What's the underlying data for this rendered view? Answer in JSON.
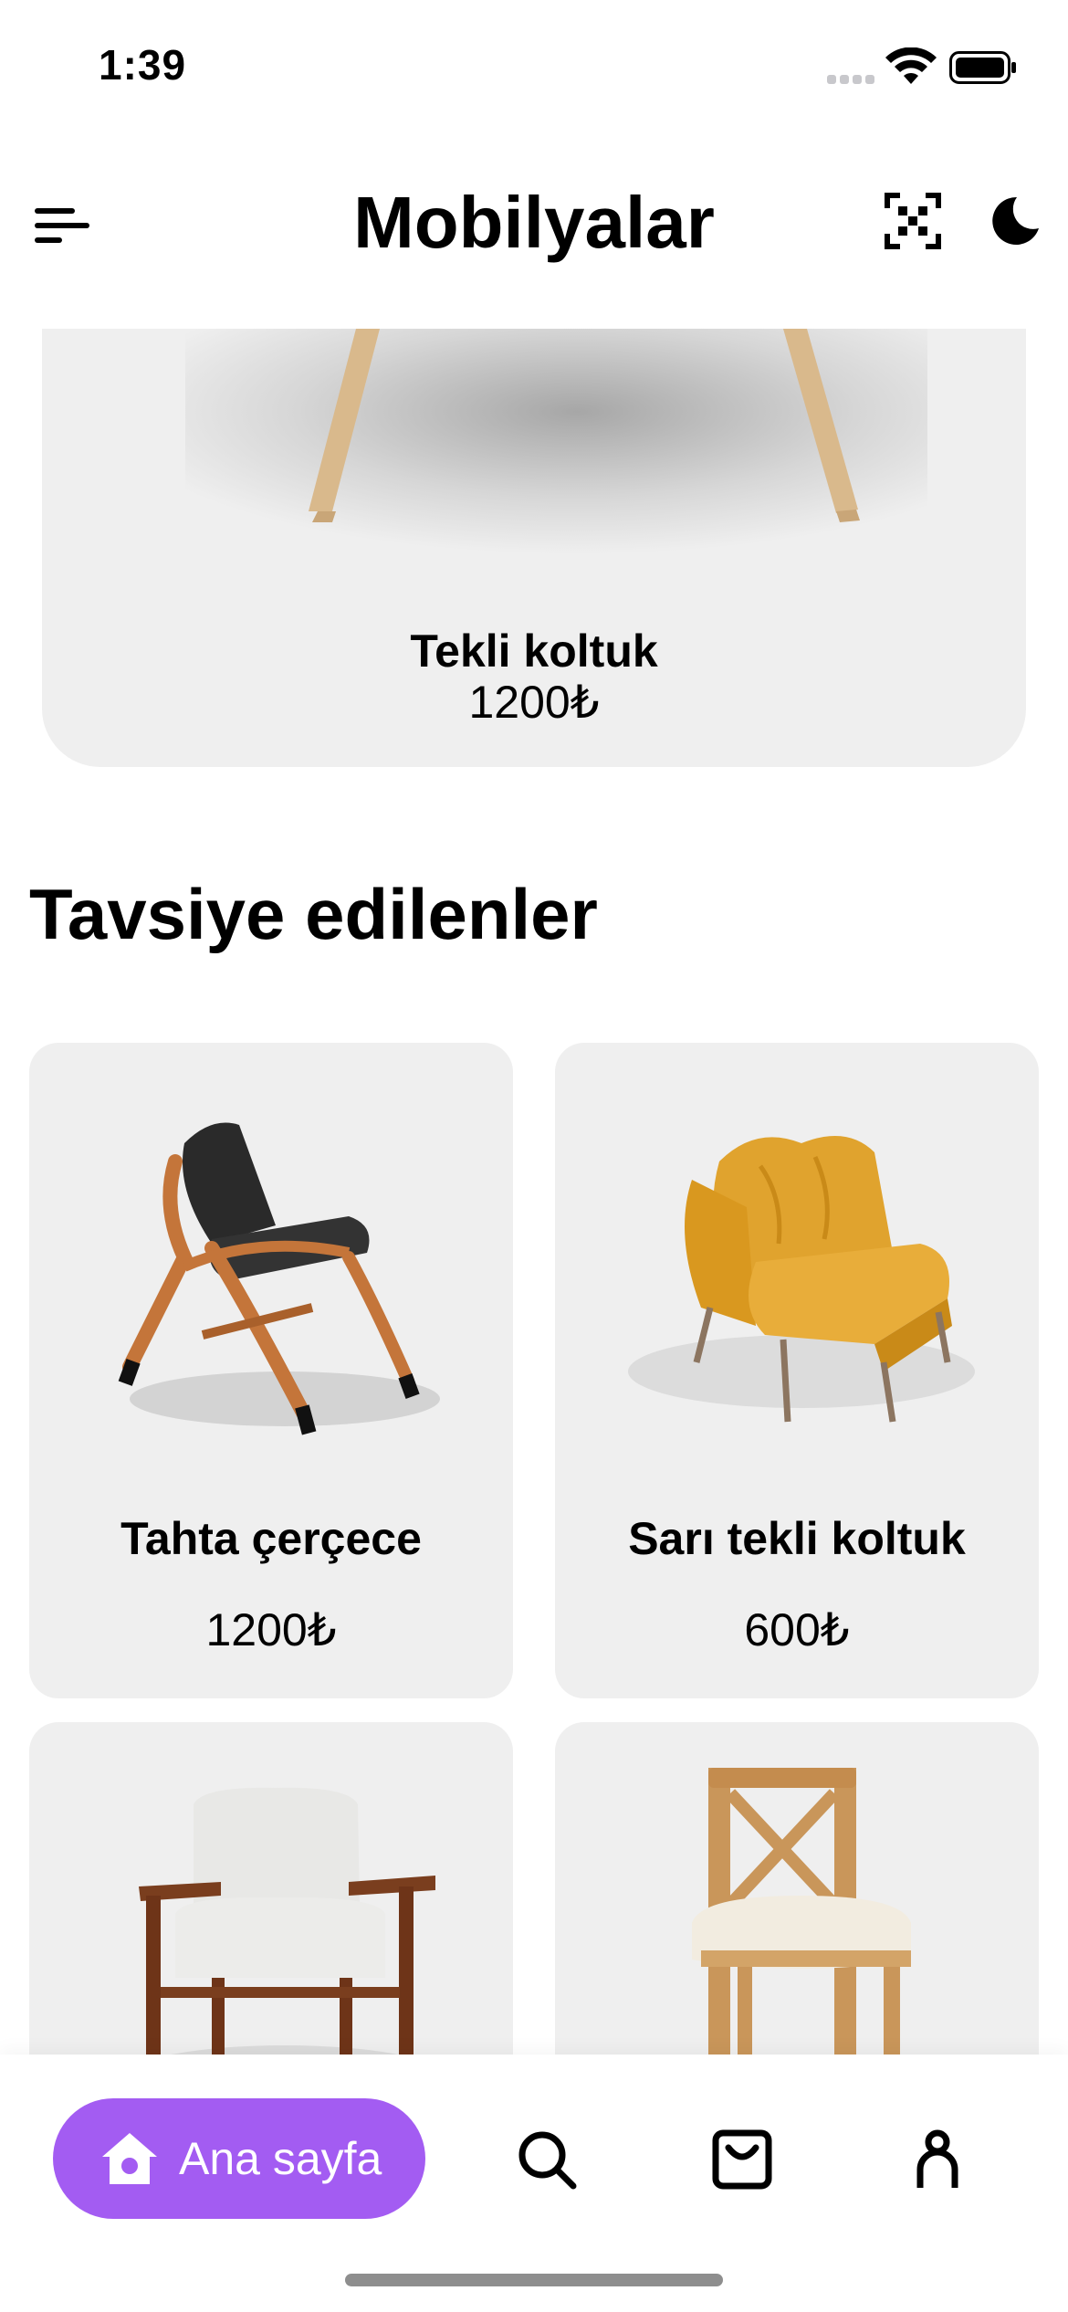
{
  "status_bar": {
    "time": "1:39"
  },
  "header": {
    "title": "Mobilyalar",
    "menu_icon": "menu-icon",
    "scan_icon": "qr-scan-icon",
    "theme_icon": "moon-icon"
  },
  "featured": {
    "name": "Tekli koltuk",
    "price": "1200₺"
  },
  "recommended": {
    "title": "Tavsiye edilenler",
    "items": [
      {
        "name": "Tahta çerçece",
        "price": "1200₺"
      },
      {
        "name": "Sarı tekli koltuk",
        "price": "600₺"
      },
      {
        "name": "",
        "price": ""
      },
      {
        "name": "",
        "price": ""
      }
    ]
  },
  "bottom_nav": {
    "home_label": "Ana sayfa",
    "icons": [
      "home-icon",
      "search-icon",
      "shopping-bag-icon",
      "profile-icon"
    ]
  },
  "colors": {
    "accent": "#a35cf2",
    "card_bg": "#efefef"
  }
}
